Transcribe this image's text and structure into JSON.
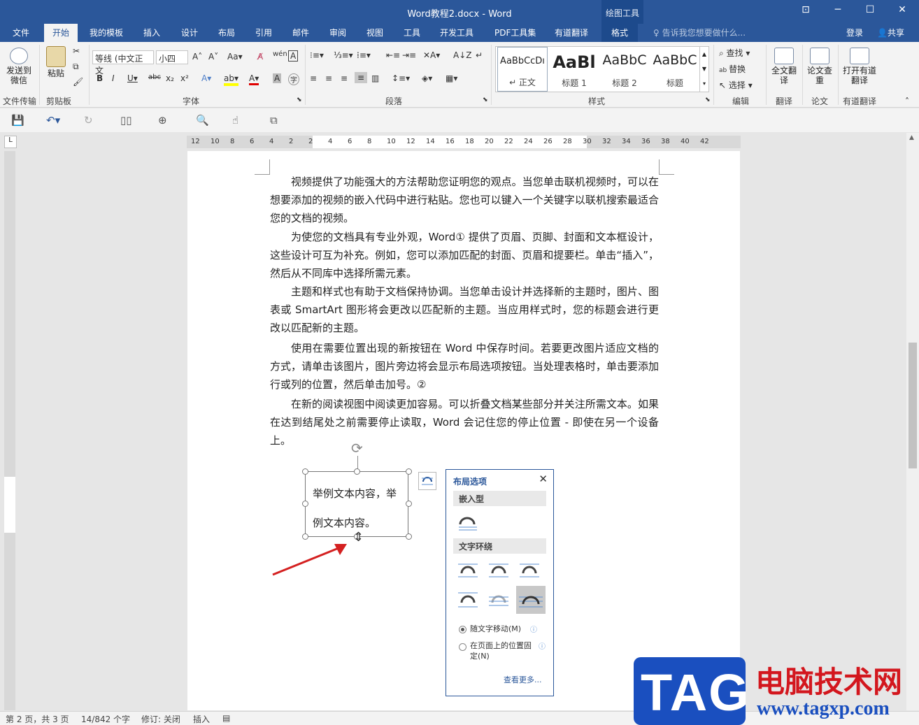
{
  "window": {
    "title": "Word教程2.docx - Word",
    "context_tool": "绘图工具"
  },
  "tabs": [
    "文件",
    "开始",
    "我的模板",
    "插入",
    "设计",
    "布局",
    "引用",
    "邮件",
    "审阅",
    "视图",
    "工具",
    "开发工具",
    "PDF工具集",
    "有道翻译",
    "格式"
  ],
  "active_tab": "开始",
  "tell_me": "告诉我您想要做什么...",
  "login": "登录",
  "share": "共享",
  "ribbon": {
    "send_wechat": "发送到微信",
    "file_transfer": "文件传输",
    "paste": "粘贴",
    "clipboard": "剪贴板",
    "font_name": "等线 (中文正文",
    "font_size": "小四",
    "font_group": "字体",
    "paragraph_group": "段落",
    "styles_group": "样式",
    "styles": [
      {
        "sample": "AaBbCcDı",
        "label": "↵ 正文"
      },
      {
        "sample": "AaBl",
        "label": "标题 1"
      },
      {
        "sample": "AaBbC",
        "label": "标题 2"
      },
      {
        "sample": "AaBbC",
        "label": "标题"
      }
    ],
    "find": "查找",
    "replace": "替换",
    "select": "选择",
    "edit_group": "编辑",
    "full_translate": "全文翻译",
    "translate_group": "翻译",
    "paper_check": "论文查重",
    "paper_group": "论文",
    "open_youdao": "打开有道翻译",
    "youdao_group": "有道翻译"
  },
  "document": {
    "paragraphs": [
      "视频提供了功能强大的方法帮助您证明您的观点。当您单击联机视频时，可以在想要添加的视频的嵌入代码中进行粘贴。您也可以键入一个关键字以联机搜索最适合您的文档的视频。",
      "为使您的文档具有专业外观，Word① 提供了页眉、页脚、封面和文本框设计，这些设计可互为补充。例如，您可以添加匹配的封面、页眉和提要栏。单击“插入”，然后从不同库中选择所需元素。",
      "主题和样式也有助于文档保持协调。当您单击设计并选择新的主题时，图片、图表或 SmartArt 图形将会更改以匹配新的主题。当应用样式时，您的标题会进行更改以匹配新的主题。",
      "使用在需要位置出现的新按钮在 Word 中保存时间。若要更改图片适应文档的方式，请单击该图片，图片旁边将会显示布局选项按钮。当处理表格时，单击要添加行或列的位置，然后单击加号。②",
      "在新的阅读视图中阅读更加容易。可以折叠文档某些部分并关注所需文本。如果在达到结尾处之前需要停止读取，Word 会记住您的停止位置 - 即使在另一个设备上。"
    ],
    "textbox": "举例文本内容，举例文本内容。"
  },
  "layout_popup": {
    "title": "布局选项",
    "close": "✕",
    "inline_section": "嵌入型",
    "wrap_section": "文字环绕",
    "move_with_text": "随文字移动(M)",
    "fix_position": "在页面上的位置固定(N)",
    "see_more": "查看更多..."
  },
  "ruler_h": [
    "12",
    "10",
    "8",
    "6",
    "4",
    "2",
    "2",
    "4",
    "6",
    "8",
    "10",
    "12",
    "14",
    "16",
    "18",
    "20",
    "22",
    "24",
    "26",
    "28",
    "30",
    "32",
    "34",
    "36",
    "38",
    "40",
    "42"
  ],
  "status": {
    "page": "第 2 页，共 3 页",
    "words": "14/842 个字",
    "revision": "修订: 关闭",
    "insert": "插入"
  },
  "watermark": {
    "tag": "TAG",
    "cn": "电脑技术网",
    "url": "www.tagxp.com"
  },
  "colors": {
    "brand": "#2b579a",
    "watermark_red": "#d3171e",
    "watermark_blue": "#1a4fbf",
    "arrow": "#d42020"
  }
}
